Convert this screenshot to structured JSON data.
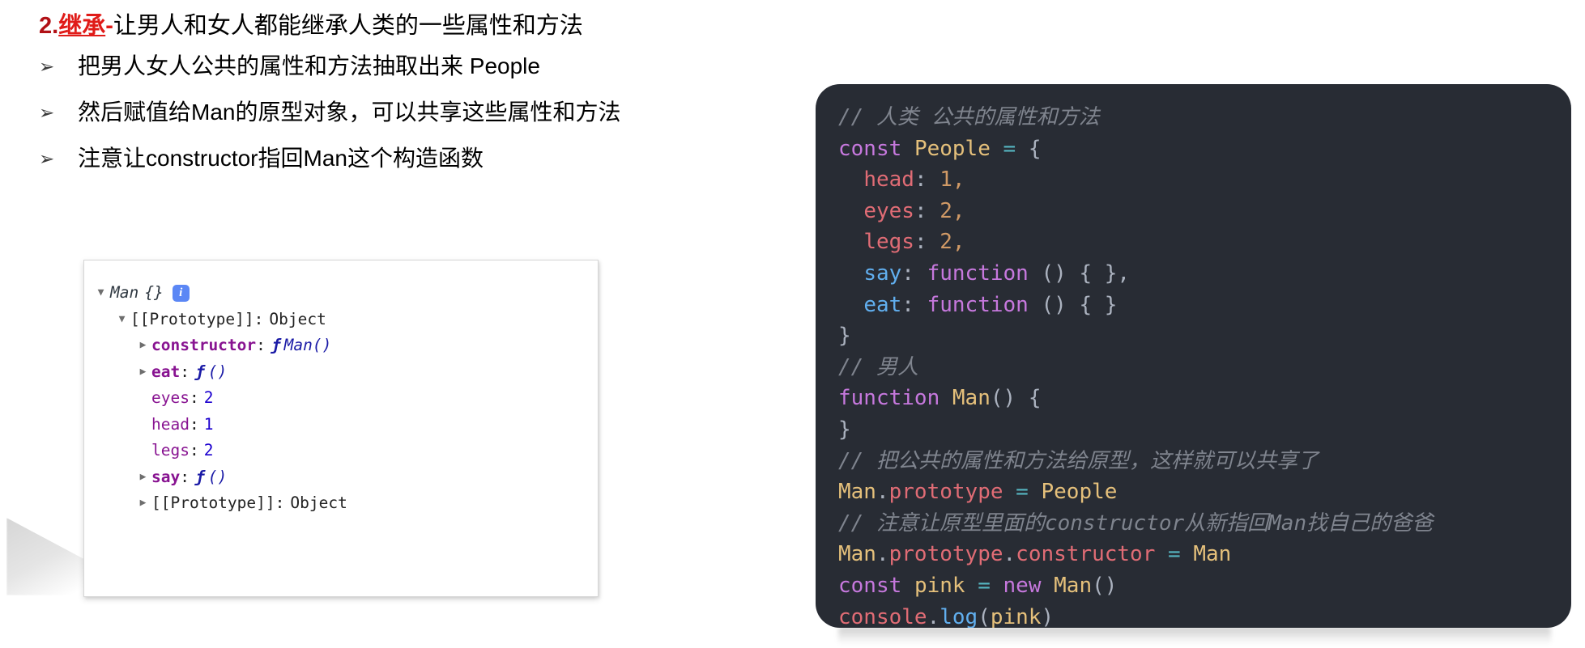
{
  "slide": {
    "heading": {
      "number": "2.",
      "keyword": "继承",
      "dash": "-",
      "rest": "让男人和女人都能继承人类的一些属性和方法",
      "keyword_color": "#e01b18",
      "number_color": "#b11116"
    },
    "bullets": [
      {
        "marker": "➢",
        "text": "把男人女人公共的属性和方法抽取出来 People"
      },
      {
        "marker": "➢",
        "text": "然后赋值给Man的原型对象，可以共享这些属性和方法"
      },
      {
        "marker": "➢",
        "text": "注意让constructor指回Man这个构造函数"
      }
    ]
  },
  "devtools": {
    "root": {
      "toggle": "▼",
      "object_name": "Man",
      "braces": "{}",
      "info_icon": "info-icon",
      "info_glyph": "i",
      "info_color": "#5b87f5"
    },
    "rows": [
      {
        "indent": 1,
        "toggle": "▼",
        "expanded": true,
        "key": "[[Prototype]]",
        "colon": ":",
        "value": "Object",
        "kind": "proto"
      },
      {
        "indent": 2,
        "toggle": "▶",
        "expanded": false,
        "key": "constructor",
        "colon": ":",
        "value": "Man()",
        "fn_glyph": "ƒ",
        "kind": "function"
      },
      {
        "indent": 2,
        "toggle": "▶",
        "expanded": false,
        "key": "eat",
        "colon": ":",
        "value": "()",
        "fn_glyph": "ƒ",
        "kind": "function"
      },
      {
        "indent": 2,
        "toggle": "",
        "expanded": false,
        "key": "eyes",
        "colon": ":",
        "value": "2",
        "kind": "number"
      },
      {
        "indent": 2,
        "toggle": "",
        "expanded": false,
        "key": "head",
        "colon": ":",
        "value": "1",
        "kind": "number"
      },
      {
        "indent": 2,
        "toggle": "",
        "expanded": false,
        "key": "legs",
        "colon": ":",
        "value": "2",
        "kind": "number"
      },
      {
        "indent": 2,
        "toggle": "▶",
        "expanded": false,
        "key": "say",
        "colon": ":",
        "value": "()",
        "fn_glyph": "ƒ",
        "kind": "function"
      },
      {
        "indent": 2,
        "toggle": "▶",
        "expanded": false,
        "key": "[[Prototype]]",
        "colon": ":",
        "value": "Object",
        "kind": "proto"
      }
    ]
  },
  "code": {
    "background": "#282c34",
    "lines": [
      {
        "id": "l1",
        "text": "// 人类 公共的属性和方法"
      },
      {
        "id": "l2",
        "text": "const People = {"
      },
      {
        "id": "l3",
        "text": "  head: 1,"
      },
      {
        "id": "l4",
        "text": "  eyes: 2,"
      },
      {
        "id": "l5",
        "text": "  legs: 2,"
      },
      {
        "id": "l6",
        "text": "  say: function () { },"
      },
      {
        "id": "l7",
        "text": "  eat: function () { }"
      },
      {
        "id": "l8",
        "text": "}"
      },
      {
        "id": "l9",
        "text": "// 男人"
      },
      {
        "id": "l10",
        "text": "function Man() {"
      },
      {
        "id": "l11",
        "text": "}"
      },
      {
        "id": "l12",
        "text": "// 把公共的属性和方法给原型，这样就可以共享了"
      },
      {
        "id": "l13",
        "text": "Man.prototype = People"
      },
      {
        "id": "l14",
        "text": "// 注意让原型里面的constructor从新指回Man找自己的爸爸"
      },
      {
        "id": "l15",
        "text": "Man.prototype.constructor = Man"
      },
      {
        "id": "l16",
        "text": "const pink = new Man()"
      },
      {
        "id": "l17",
        "text": "console.log(pink)"
      }
    ],
    "palette": {
      "comment": "#7f848e",
      "keyword": "#c678dd",
      "variable": "#e5c07b",
      "operator": "#56b6c2",
      "property": "#e06c75",
      "method": "#61afef",
      "number": "#d19a66",
      "plain": "#abb2bf"
    }
  }
}
